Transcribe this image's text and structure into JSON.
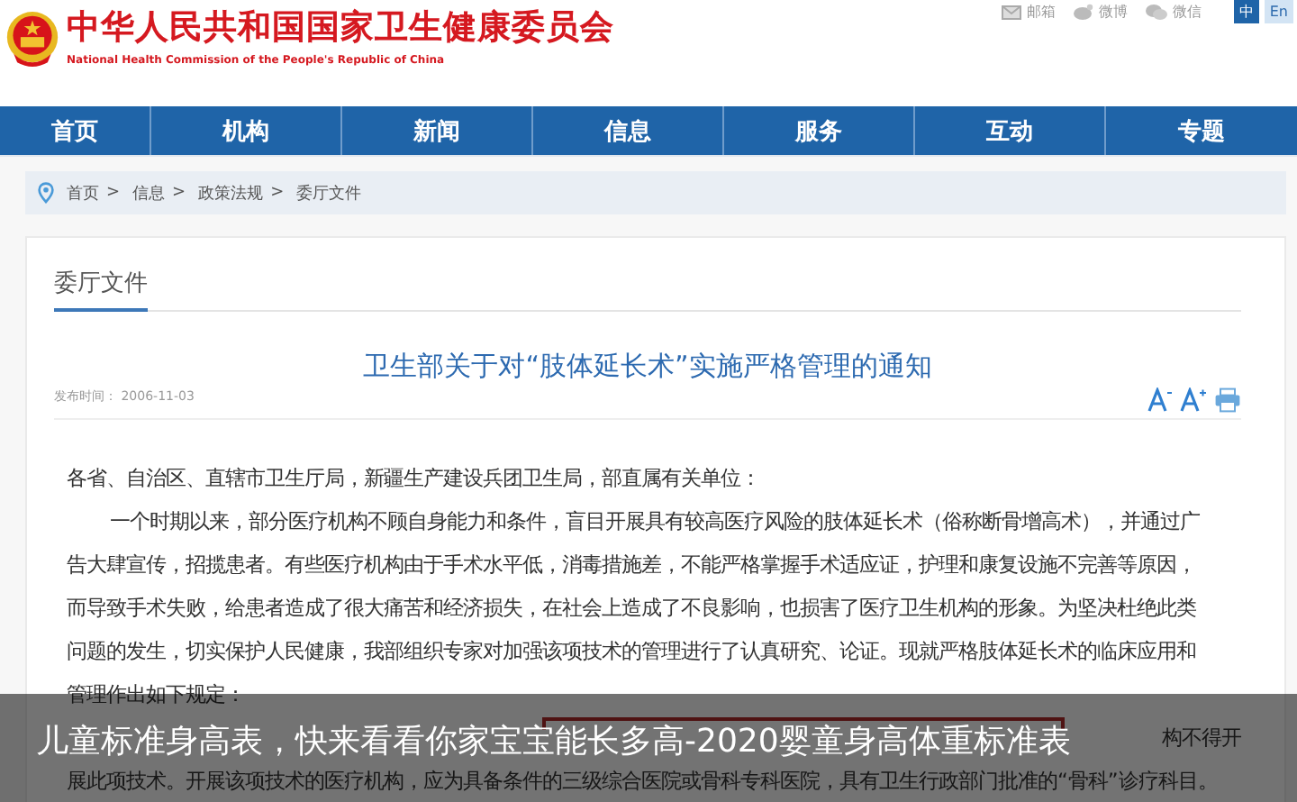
{
  "header": {
    "title": "中华人民共和国国家卫生健康委员会",
    "subtitle": "National Health Commission of the People's Republic of China",
    "links": [
      {
        "kind": "mail",
        "label": "邮箱"
      },
      {
        "kind": "weibo",
        "label": "微博"
      },
      {
        "kind": "wechat",
        "label": "微信"
      }
    ],
    "languages": [
      {
        "label": "中",
        "selected": true
      },
      {
        "label": "En",
        "selected": false
      }
    ]
  },
  "nav": [
    "首页",
    "机构",
    "新闻",
    "信息",
    "服务",
    "互动",
    "专题"
  ],
  "breadcrumb": [
    "首页",
    "信息",
    "政策法规",
    "委厅文件"
  ],
  "breadcrumb_separator": ">",
  "section_title": "委厅文件",
  "article": {
    "title": "卫生部关于对“肢体延长术”实施严格管理的通知",
    "date_label": "发布时间：",
    "date": "2006-11-03",
    "paragraphs": [
      {
        "kind": "salutation",
        "text": "各省、自治区、直辖市卫生厅局，新疆生产建设兵团卫生局，部直属有关单位："
      },
      {
        "kind": "indent",
        "lines": [
          "一个时期以来，部分医疗机构不顾自身能力和条件，盲目开展具有较高医疗风险的肢体延长术（俗称断骨增高术），并通过广",
          "告大肆宣传，招揽患者。有些医疗机构由于手术水平低，消毒措施差，不能严格掌握手术适应证，护理和康复设施不完善等原因，",
          "而导致手术失败，给患者造成了很大痛苦和经济损失，在社会上造成了不良影响，也损害了医疗卫生机构的形象。为坚决杜绝此类",
          "问题的发生，切实保护人民健康，我部组织专家对加强该项技术的管理进行了认真研究、论证。现就严格肢体延长术的临床应用和",
          "管理作出如下规定："
        ]
      },
      {
        "kind": "covered",
        "text": "构不得开"
      },
      {
        "kind": "plain",
        "text": "展此项技术。开展该项技术的医疗机构，应为具备条件的三级综合医院或骨科专科医院，具有卫生行政部门批准的“骨科”诊疗科目。"
      }
    ]
  },
  "caption": "儿童标准身高表，快来看看你家宝宝能长多高-2020婴童身高体重标准表"
}
